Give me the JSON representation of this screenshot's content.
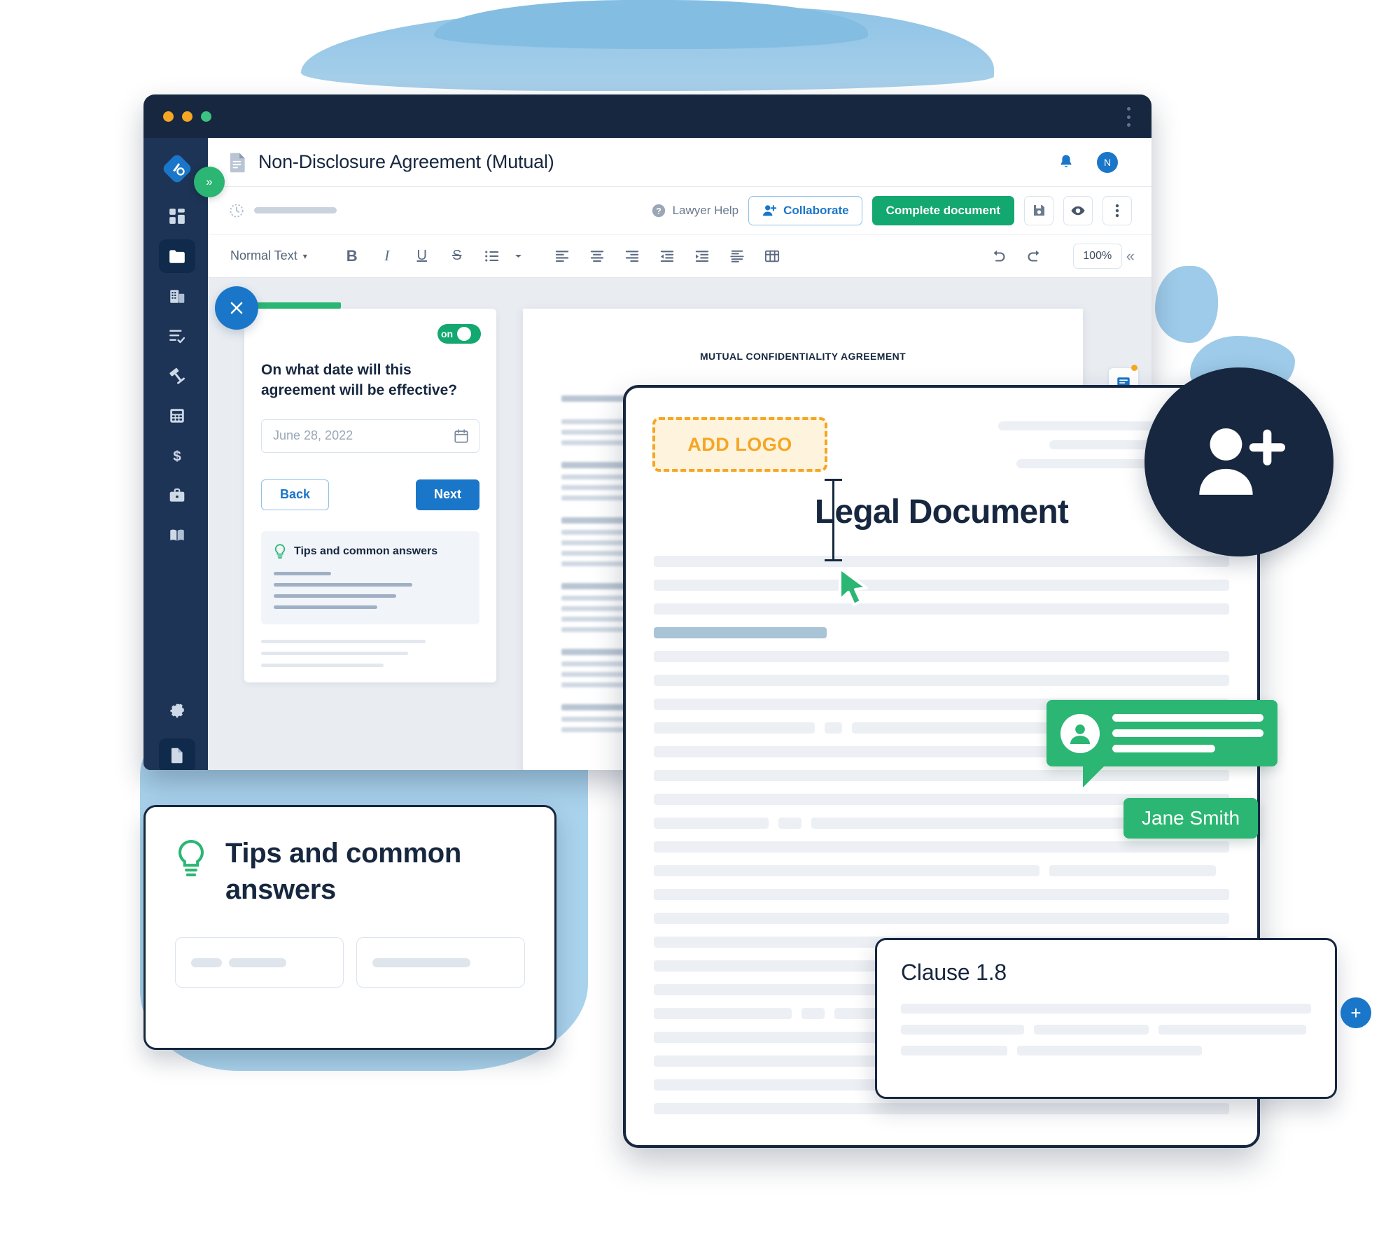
{
  "window": {
    "traffic_lights": [
      "close",
      "minimize",
      "maximize"
    ],
    "menu_icon": "vertical-dots-icon"
  },
  "sidebar": {
    "logo": "app-logo-icon",
    "collapse_label": "»",
    "items": [
      {
        "name": "dashboard",
        "icon": "dashboard-grid-icon"
      },
      {
        "name": "documents",
        "icon": "folder-icon",
        "active": true
      },
      {
        "name": "company",
        "icon": "building-icon"
      },
      {
        "name": "tasks",
        "icon": "checklist-icon"
      },
      {
        "name": "legal",
        "icon": "gavel-icon"
      },
      {
        "name": "calculator",
        "icon": "calculator-icon"
      },
      {
        "name": "finance",
        "icon": "dollar-icon"
      },
      {
        "name": "briefcase",
        "icon": "briefcase-icon"
      },
      {
        "name": "library",
        "icon": "book-icon"
      },
      {
        "name": "settings",
        "icon": "gear-icon"
      },
      {
        "name": "document-active",
        "icon": "document-icon",
        "active": true
      }
    ]
  },
  "header": {
    "doc_icon": "document-file-icon",
    "title": "Non-Disclosure Agreement (Mutual)",
    "bell_icon": "bell-icon",
    "avatar_initial": "N"
  },
  "action_bar": {
    "clock_icon": "history-clock-icon",
    "lawyer_help_label": "Lawyer Help",
    "help_icon": "question-circle-icon",
    "collaborate_label": "Collaborate",
    "collaborate_icon": "person-plus-icon",
    "complete_label": "Complete document",
    "save_icon": "save-disk-icon",
    "preview_icon": "eye-icon",
    "more_icon": "vertical-dots-icon"
  },
  "format_bar": {
    "style_label": "Normal Text",
    "style_caret": "▾",
    "bold": "B",
    "italic": "I",
    "underline": "U",
    "strikethrough": "S",
    "list_icon": "bulleted-list-icon",
    "align_left_icon": "align-left-icon",
    "align_center_icon": "align-center-icon",
    "align_right_icon": "align-right-icon",
    "indent_decrease_icon": "indent-decrease-icon",
    "indent_increase_icon": "indent-increase-icon",
    "page_break_icon": "page-break-icon",
    "table_icon": "table-icon",
    "undo_icon": "undo-icon",
    "redo_icon": "redo-icon",
    "zoom_level": "100%",
    "collapse_icon": "chevron-double-left-icon"
  },
  "question_panel": {
    "close_icon": "close-x-icon",
    "toggle_label": "on",
    "question": "On what date will this agreement will be effective?",
    "date_placeholder": "June 28, 2022",
    "calendar_icon": "calendar-icon",
    "back_label": "Back",
    "next_label": "Next",
    "tips_icon": "lightbulb-icon",
    "tips_title": "Tips and common answers"
  },
  "document_preview": {
    "heading": "MUTUAL CONFIDENTIALITY AGREEMENT"
  },
  "side_tools": [
    {
      "name": "comments-tool",
      "icon": "comment-icon"
    },
    {
      "name": "search-tool",
      "icon": "search-zoom-icon"
    },
    {
      "name": "edit-tool",
      "icon": "pencil-edit-icon"
    }
  ],
  "tips_card": {
    "icon": "lightbulb-icon",
    "title": "Tips and common answers"
  },
  "legal_card": {
    "add_logo_label": "ADD LOGO",
    "title": "Legal Document",
    "cursor_icon": "mouse-pointer-icon",
    "caret_icon": "text-caret-icon"
  },
  "comment": {
    "avatar_icon": "person-avatar-icon",
    "author": "Jane Smith"
  },
  "clause_card": {
    "title": "Clause 1.8"
  },
  "collab_badge": {
    "icon": "person-plus-icon"
  },
  "plus_chip": {
    "label": "+"
  },
  "colors": {
    "brand_dark": "#16273f",
    "brand_blue": "#1a76c8",
    "brand_green": "#13a870",
    "accent_green": "#2bb673",
    "accent_orange": "#f5a623",
    "watercolor_blue": "#9cc9e8"
  }
}
